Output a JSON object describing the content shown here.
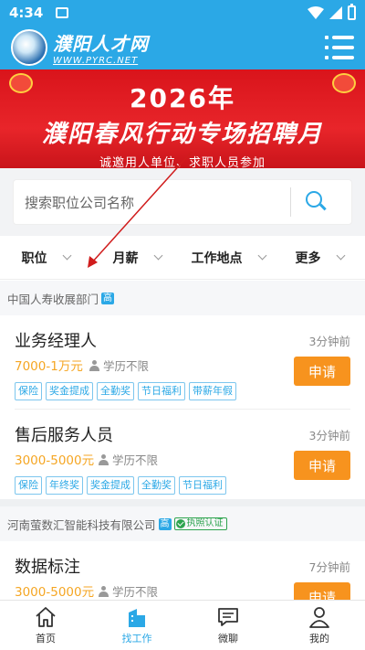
{
  "status_bar": {
    "time": "4:34"
  },
  "header": {
    "logo_title": "濮阳人才网",
    "logo_url": "WWW.PYRC.NET",
    "brand_color": "#2ba8e6"
  },
  "banner": {
    "year": "2026年",
    "title": "濮阳春风行动专场招聘月",
    "subtitle": "诚邀用人单位、求职人员参加"
  },
  "search": {
    "placeholder": "搜索职位公司名称"
  },
  "filters": [
    {
      "label": "职位"
    },
    {
      "label": "月薪"
    },
    {
      "label": "工作地点"
    },
    {
      "label": "更多"
    }
  ],
  "companies": [
    {
      "name": "中国人寿收展部门",
      "badge": "高",
      "jobs": [
        {
          "title": "业务经理人",
          "time": "3分钟前",
          "salary": "7000-1万元",
          "education": "学历不限",
          "tags": [
            "保险",
            "奖金提成",
            "全勤奖",
            "节日福利",
            "带薪年假"
          ],
          "apply_label": "申请"
        },
        {
          "title": "售后服务人员",
          "time": "3分钟前",
          "salary": "3000-5000元",
          "education": "学历不限",
          "tags": [
            "保险",
            "年终奖",
            "奖金提成",
            "全勤奖",
            "节日福利"
          ],
          "apply_label": "申请"
        }
      ]
    },
    {
      "name": "河南萤数汇智能科技有限公司",
      "badge": "高",
      "cert": "执照认证",
      "jobs": [
        {
          "title": "数据标注",
          "time": "7分钟前",
          "salary": "3000-5000元",
          "education": "学历不限",
          "apply_label": "申请"
        }
      ]
    }
  ],
  "bottom_nav": [
    {
      "label": "首页",
      "icon": "home-icon"
    },
    {
      "label": "找工作",
      "icon": "building-icon",
      "active": true
    },
    {
      "label": "微聊",
      "icon": "chat-icon"
    },
    {
      "label": "我的",
      "icon": "person-icon"
    }
  ],
  "colors": {
    "accent": "#2ba8e6",
    "apply": "#f7931e",
    "salary": "#f5a623",
    "banner": "#e8252a"
  }
}
